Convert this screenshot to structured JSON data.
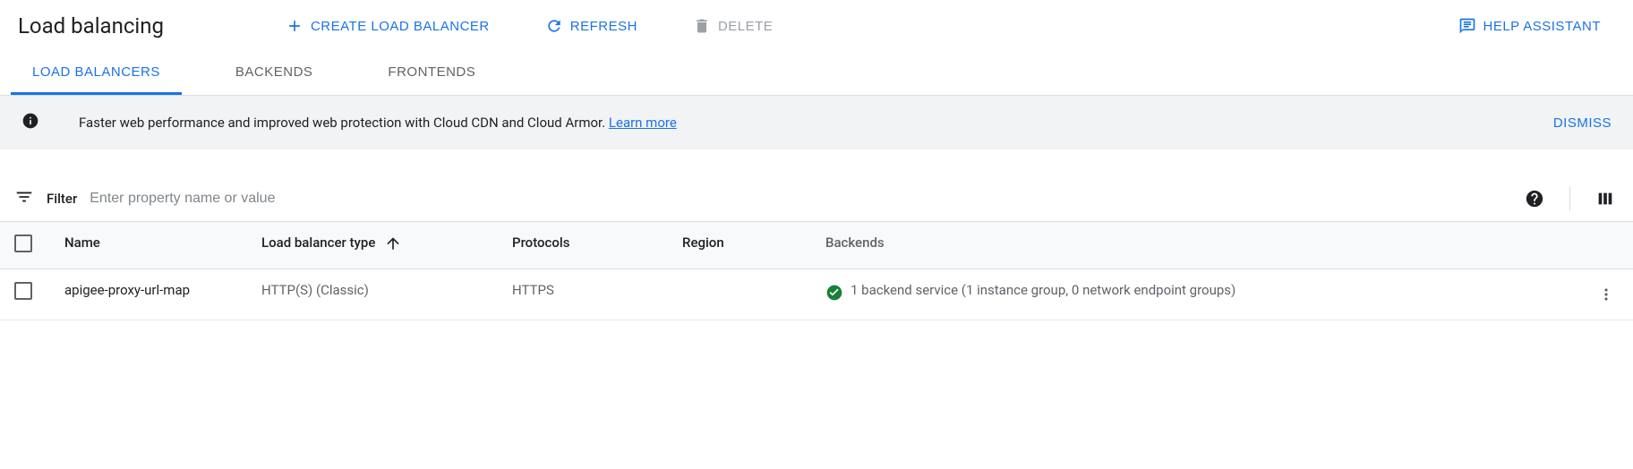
{
  "header": {
    "title": "Load balancing",
    "create_label": "Create load balancer",
    "refresh_label": "Refresh",
    "delete_label": "Delete",
    "help_label": "Help Assistant"
  },
  "tabs": {
    "load_balancers": "Load balancers",
    "backends": "Backends",
    "frontends": "Frontends"
  },
  "banner": {
    "text": "Faster web performance and improved web protection with Cloud CDN and Cloud Armor. ",
    "learn_more": "Learn more",
    "dismiss": "DISMISS"
  },
  "filter": {
    "label": "Filter",
    "placeholder": "Enter property name or value"
  },
  "table": {
    "headers": {
      "name": "Name",
      "type": "Load balancer type",
      "protocols": "Protocols",
      "region": "Region",
      "backends": "Backends"
    },
    "rows": [
      {
        "name": "apigee-proxy-url-map",
        "type": "HTTP(S) (Classic)",
        "protocols": "HTTPS",
        "region": "",
        "backends": "1 backend service (1 instance group, 0 network endpoint groups)"
      }
    ]
  }
}
